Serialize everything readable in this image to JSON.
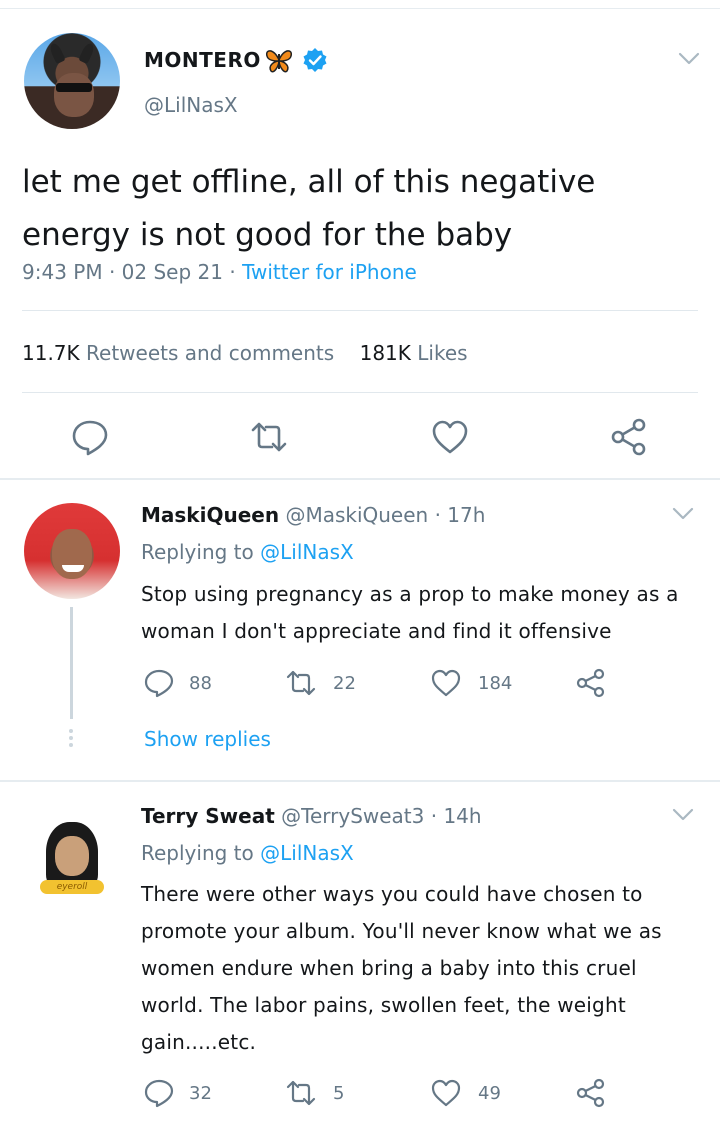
{
  "tweet": {
    "display_name": "MONTERO",
    "handle": "@LilNasX",
    "text": "let me get offline, all of this negative energy is not good for the baby",
    "time": "9:43 PM",
    "date": "02 Sep 21",
    "source": "Twitter for iPhone",
    "retweets_count": "11.7K",
    "retweets_label": "Retweets and comments",
    "likes_count": "181K",
    "likes_label": "Likes",
    "icons": [
      "avatar",
      "butterfly-emoji",
      "verified-badge",
      "chevron-down-icon",
      "reply-icon",
      "retweet-icon",
      "like-icon",
      "share-icon"
    ]
  },
  "replies": [
    {
      "display_name": "MaskiQueen",
      "handle": "@MaskiQueen",
      "age": "17h",
      "replying_label": "Replying to",
      "replying_to": "@LilNasX",
      "text": "Stop using pregnancy as a prop to make money as a woman I don't appreciate and find it offensive",
      "reply_count": "88",
      "retweet_count": "22",
      "like_count": "184",
      "show_replies": "Show replies"
    },
    {
      "display_name": "Terry Sweat",
      "handle": "@TerrySweat3",
      "age": "14h",
      "replying_label": "Replying to",
      "replying_to": "@LilNasX",
      "avatar_tag": "eyeroll",
      "text": "There were other ways you could have chosen to promote your album. You'll never know what we as women endure when bring a baby into this cruel world.   The labor pains, swollen feet, the weight gain.....etc.",
      "reply_count": "32",
      "retweet_count": "5",
      "like_count": "49"
    }
  ],
  "colors": {
    "accent": "#1da1f2",
    "secondary_text": "#657786",
    "primary_text": "#14171a",
    "divider": "#e1e8ed"
  }
}
